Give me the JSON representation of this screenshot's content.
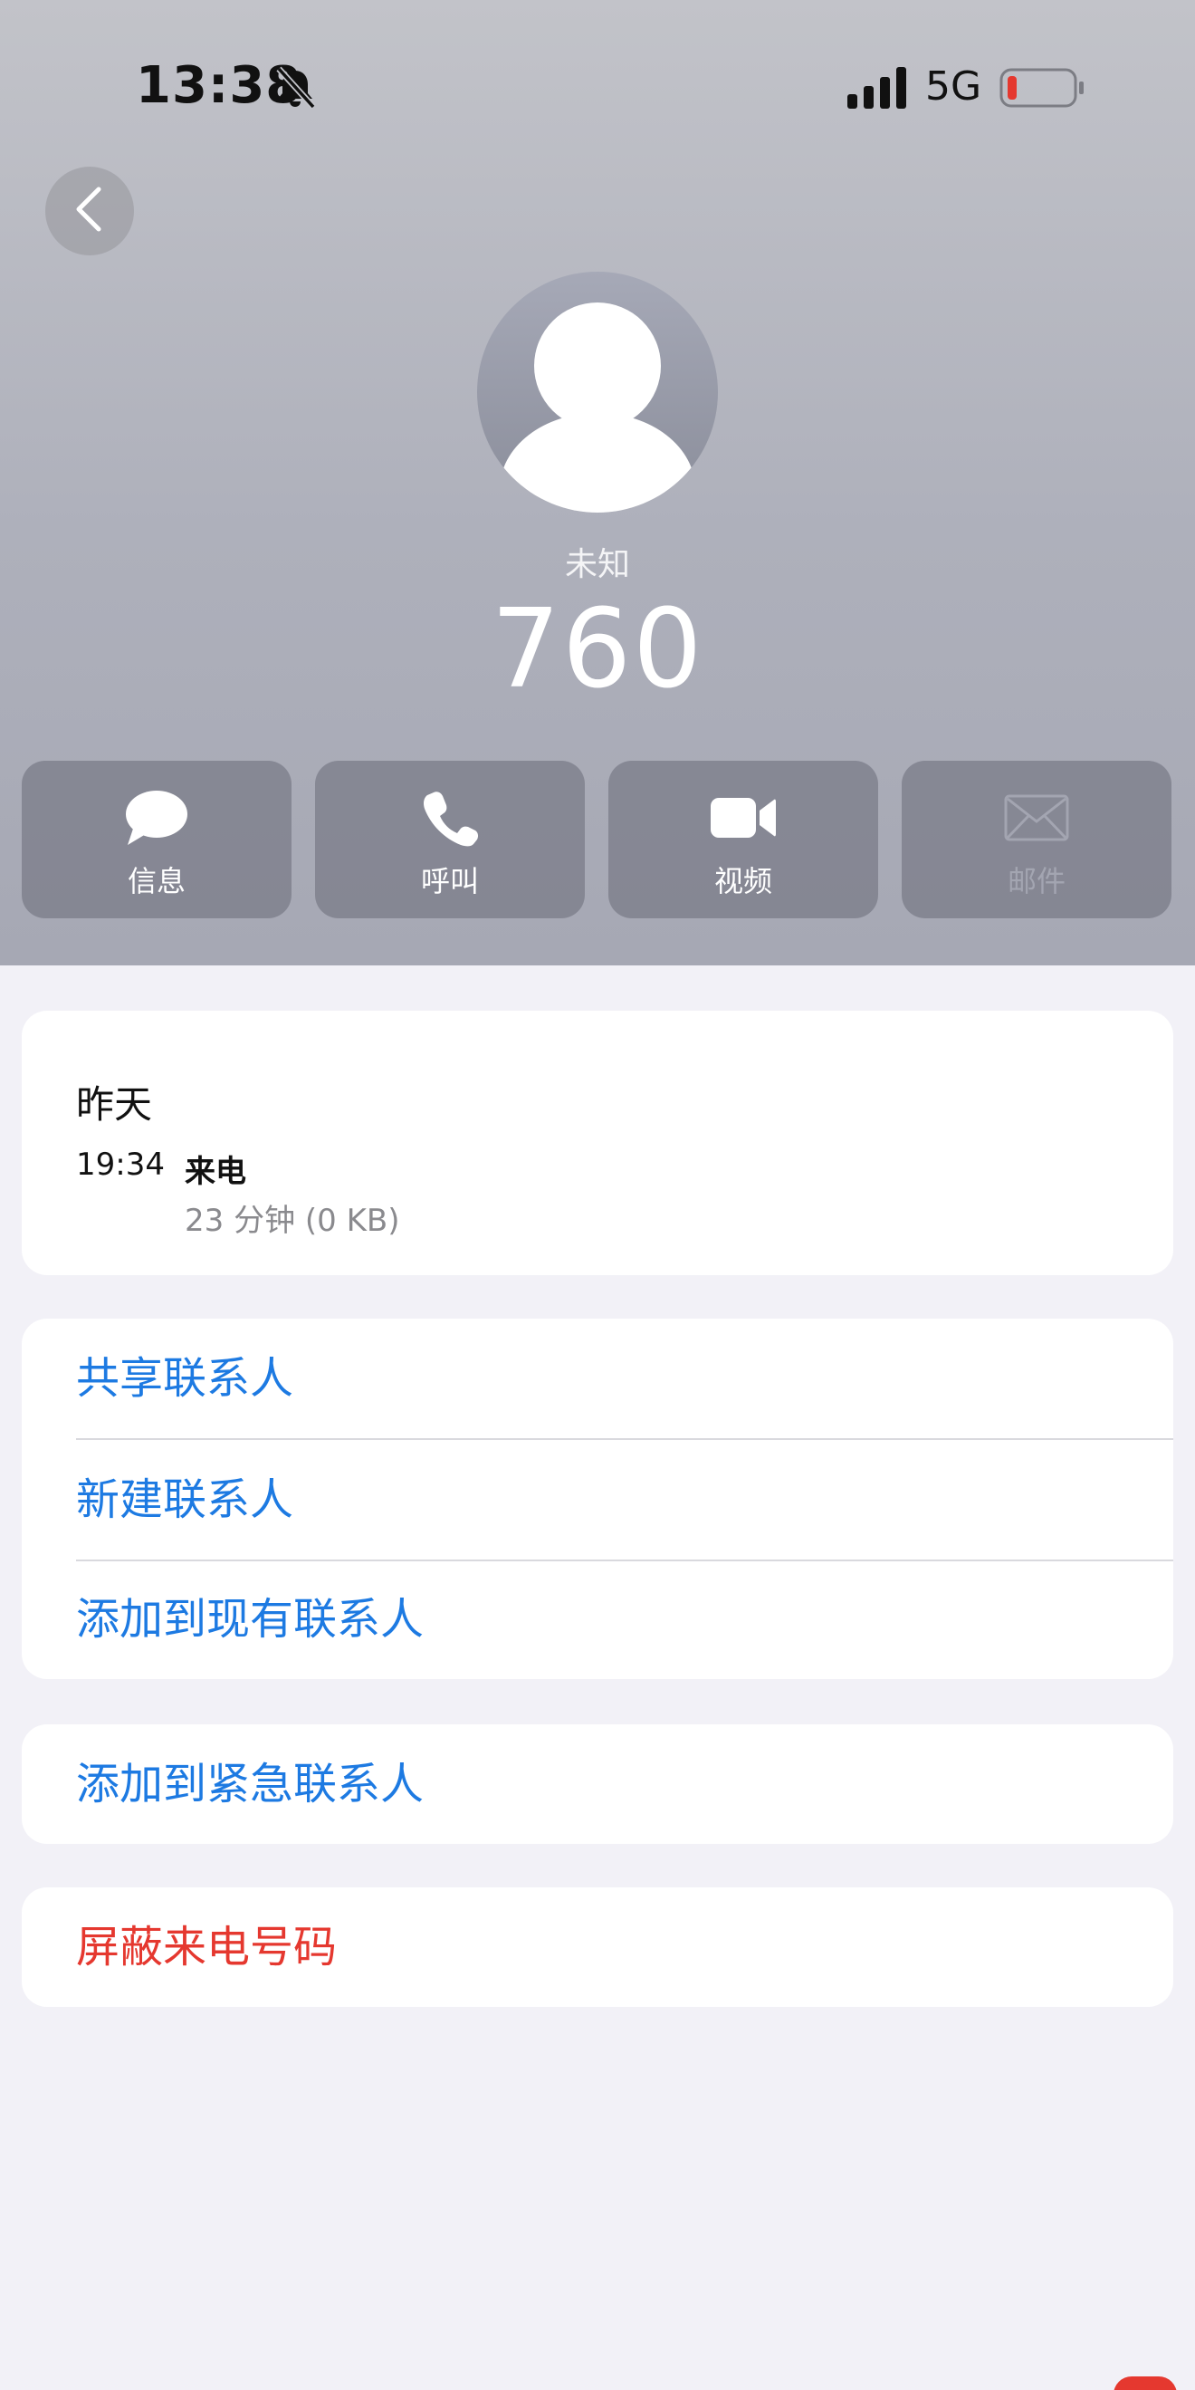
{
  "status_bar": {
    "time": "13:38",
    "network": "5G",
    "icons": [
      "bell-slash-icon",
      "cellular-signal-icon",
      "battery-low-icon"
    ],
    "battery_color": "#e5382f"
  },
  "navigation": {
    "back_icon": "chevron-left-icon"
  },
  "contact": {
    "avatar_icon": "person-placeholder-icon",
    "label": "未知",
    "number": "760"
  },
  "actions": [
    {
      "label": "信息",
      "icon": "message-bubble-icon",
      "enabled": true
    },
    {
      "label": "呼叫",
      "icon": "phone-icon",
      "enabled": true
    },
    {
      "label": "视频",
      "icon": "video-camera-icon",
      "enabled": true
    },
    {
      "label": "邮件",
      "icon": "envelope-icon",
      "enabled": false
    }
  ],
  "call_history": {
    "day": "昨天",
    "entries": [
      {
        "time": "19:34",
        "type": "来电",
        "duration": "23 分钟 (0 KB)"
      }
    ]
  },
  "menu_group_1": [
    {
      "label": "共享联系人"
    },
    {
      "label": "新建联系人"
    },
    {
      "label": "添加到现有联系人"
    }
  ],
  "menu_group_2": [
    {
      "label": "添加到紧急联系人"
    }
  ],
  "menu_group_3": [
    {
      "label": "屏蔽来电号码"
    }
  ],
  "colors": {
    "link_blue": "#1d7ae2",
    "danger_red": "#e5382f",
    "background": "#f2f1f7"
  }
}
